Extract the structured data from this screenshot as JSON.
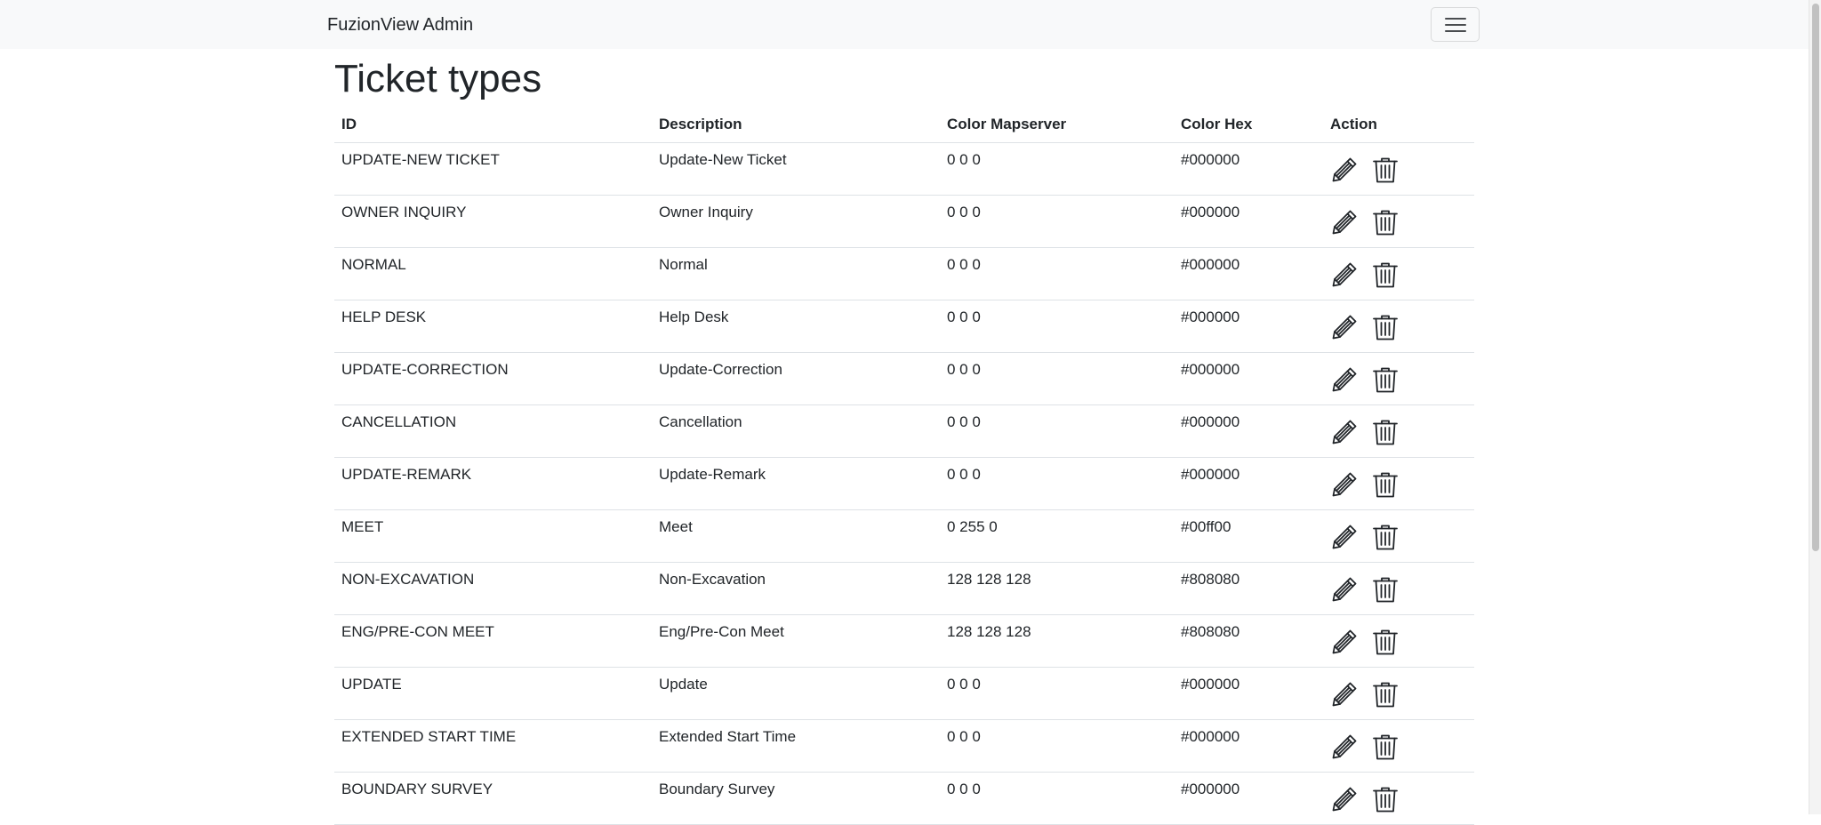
{
  "navbar": {
    "brand": "FuzionView Admin",
    "toggler_icon": "hamburger-icon"
  },
  "page": {
    "title": "Ticket types"
  },
  "table": {
    "headers": {
      "id": "ID",
      "description": "Description",
      "color_mapserver": "Color Mapserver",
      "color_hex": "Color Hex",
      "action": "Action"
    },
    "action_icons": [
      "pencil-icon",
      "trash-icon"
    ],
    "rows": [
      {
        "id": "UPDATE-NEW TICKET",
        "description": "Update-New Ticket",
        "color_mapserver": "0 0 0",
        "color_hex": "#000000"
      },
      {
        "id": "OWNER INQUIRY",
        "description": "Owner Inquiry",
        "color_mapserver": "0 0 0",
        "color_hex": "#000000"
      },
      {
        "id": "NORMAL",
        "description": "Normal",
        "color_mapserver": "0 0 0",
        "color_hex": "#000000"
      },
      {
        "id": "HELP DESK",
        "description": "Help Desk",
        "color_mapserver": "0 0 0",
        "color_hex": "#000000"
      },
      {
        "id": "UPDATE-CORRECTION",
        "description": "Update-Correction",
        "color_mapserver": "0 0 0",
        "color_hex": "#000000"
      },
      {
        "id": "CANCELLATION",
        "description": "Cancellation",
        "color_mapserver": "0 0 0",
        "color_hex": "#000000"
      },
      {
        "id": "UPDATE-REMARK",
        "description": "Update-Remark",
        "color_mapserver": "0 0 0",
        "color_hex": "#000000"
      },
      {
        "id": "MEET",
        "description": "Meet",
        "color_mapserver": "0 255 0",
        "color_hex": "#00ff00"
      },
      {
        "id": "NON-EXCAVATION",
        "description": "Non-Excavation",
        "color_mapserver": "128 128 128",
        "color_hex": "#808080"
      },
      {
        "id": "ENG/PRE-CON MEET",
        "description": "Eng/Pre-Con Meet",
        "color_mapserver": "128 128 128",
        "color_hex": "#808080"
      },
      {
        "id": "UPDATE",
        "description": "Update",
        "color_mapserver": "0 0 0",
        "color_hex": "#000000"
      },
      {
        "id": "EXTENDED START TIME",
        "description": "Extended Start Time",
        "color_mapserver": "0 0 0",
        "color_hex": "#000000"
      },
      {
        "id": "BOUNDARY SURVEY",
        "description": "Boundary Survey",
        "color_mapserver": "0 0 0",
        "color_hex": "#000000"
      }
    ]
  }
}
